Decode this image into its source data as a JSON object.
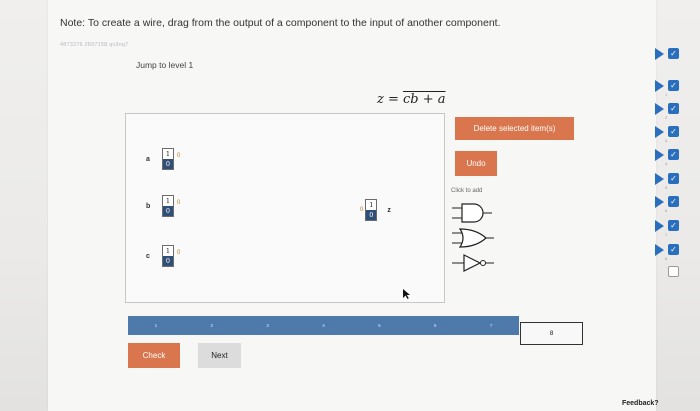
{
  "note": "Note: To create a wire, drag from the output of a component to the input of another component.",
  "watermark": "4873276 2697158 qv3nq7",
  "level_title": "Jump to level 1",
  "equation": {
    "lhs": "z = ",
    "overline_part": "cb + a"
  },
  "buttons": {
    "delete": "Delete selected item(s)",
    "undo": "Undo",
    "check": "Check",
    "next": "Next"
  },
  "palette": {
    "title": "Click to add",
    "gates": [
      "and-gate-icon",
      "or-gate-icon",
      "not-gate-icon"
    ]
  },
  "inputs": [
    {
      "label": "a",
      "top": "1",
      "bottom": "0",
      "out": "0"
    },
    {
      "label": "b",
      "top": "1",
      "bottom": "0",
      "out": "0"
    },
    {
      "label": "c",
      "top": "1",
      "bottom": "0",
      "out": "0"
    }
  ],
  "output": {
    "label": "z",
    "top": "1",
    "bottom": "0",
    "in": "0"
  },
  "level_bar": {
    "levels": [
      "1",
      "2",
      "3",
      "4",
      "5",
      "6",
      "7"
    ],
    "current": "8"
  },
  "sidebar": {
    "items": [
      {
        "num": "",
        "state": "checked"
      },
      {
        "num": "1",
        "state": "checked"
      },
      {
        "num": "2",
        "state": "checked"
      },
      {
        "num": "3",
        "state": "checked"
      },
      {
        "num": "4",
        "state": "checked"
      },
      {
        "num": "5",
        "state": "checked"
      },
      {
        "num": "6",
        "state": "checked"
      },
      {
        "num": "7",
        "state": "checked"
      },
      {
        "num": "8",
        "state": "empty"
      }
    ]
  },
  "feedback": "Feedback?",
  "colors": {
    "accent": "#d9764e",
    "bar": "#4d79ab",
    "switch_on": "#2f4e78",
    "check_blue": "#2a6fbe"
  }
}
